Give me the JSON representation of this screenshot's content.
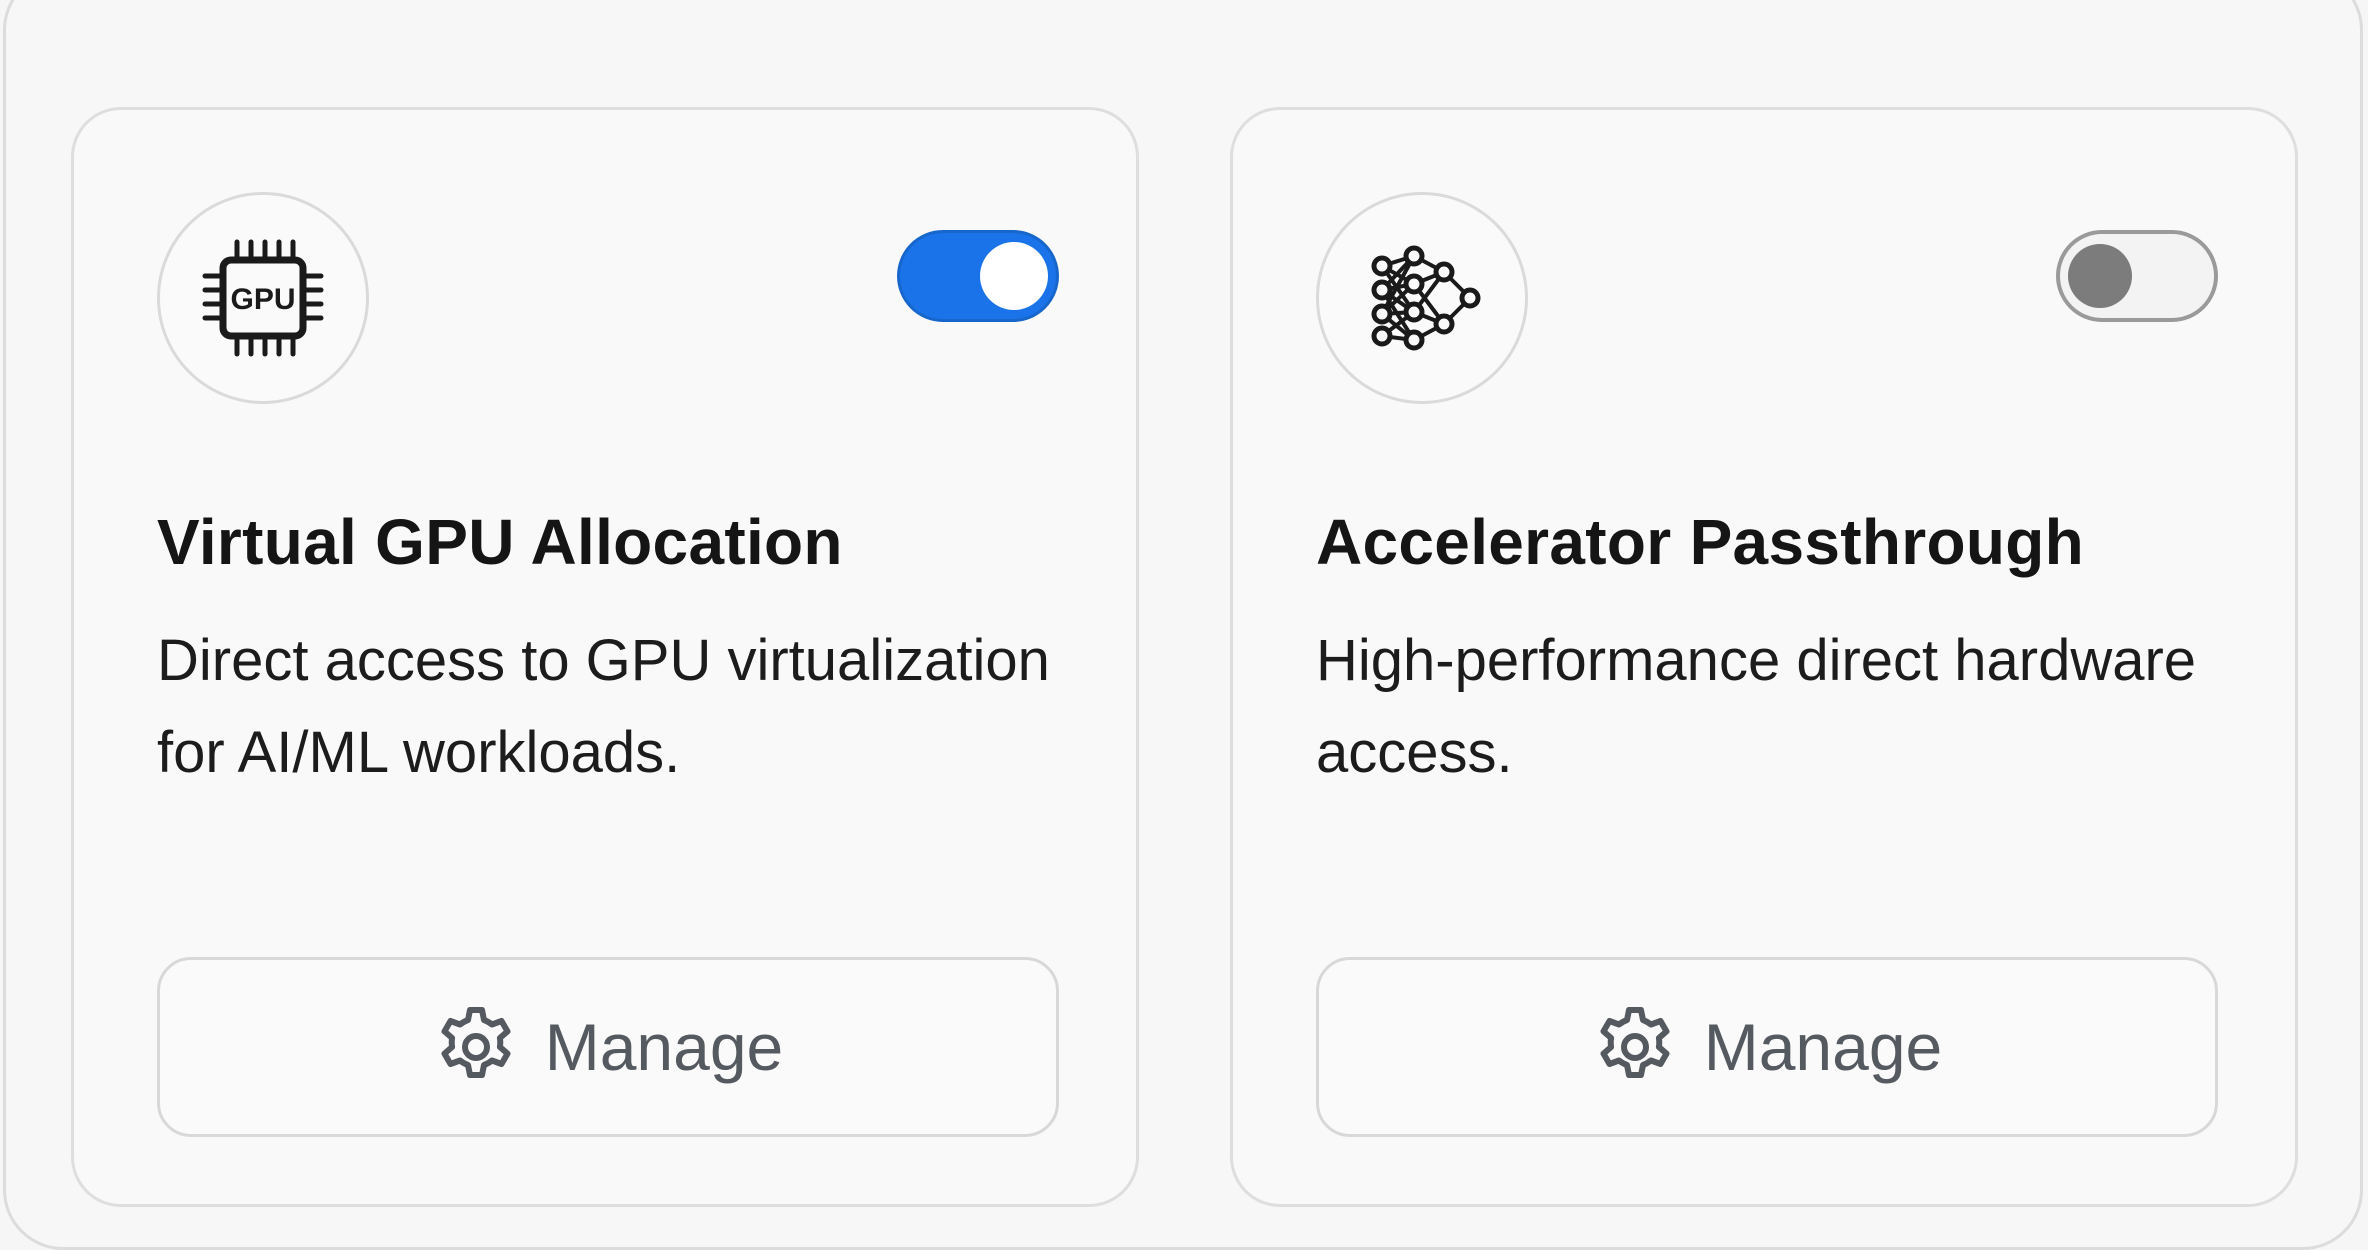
{
  "cards": [
    {
      "icon": "gpu-chip-icon",
      "icon_text": "GPU",
      "title": "Virtual GPU Allocation",
      "description": "Direct access to GPU virtualization for AI/ML workloads.",
      "enabled": true,
      "button_label": "Manage",
      "button_icon": "gear-icon"
    },
    {
      "icon": "neural-network-icon",
      "title": "Accelerator Passthrough",
      "description": "High-performance direct hardware access.",
      "enabled": false,
      "button_label": "Manage",
      "button_icon": "gear-icon"
    }
  ],
  "colors": {
    "toggle_on": "#1a73e8",
    "toggle_off_knob": "#7c7c7c",
    "button_text": "#555a60"
  }
}
